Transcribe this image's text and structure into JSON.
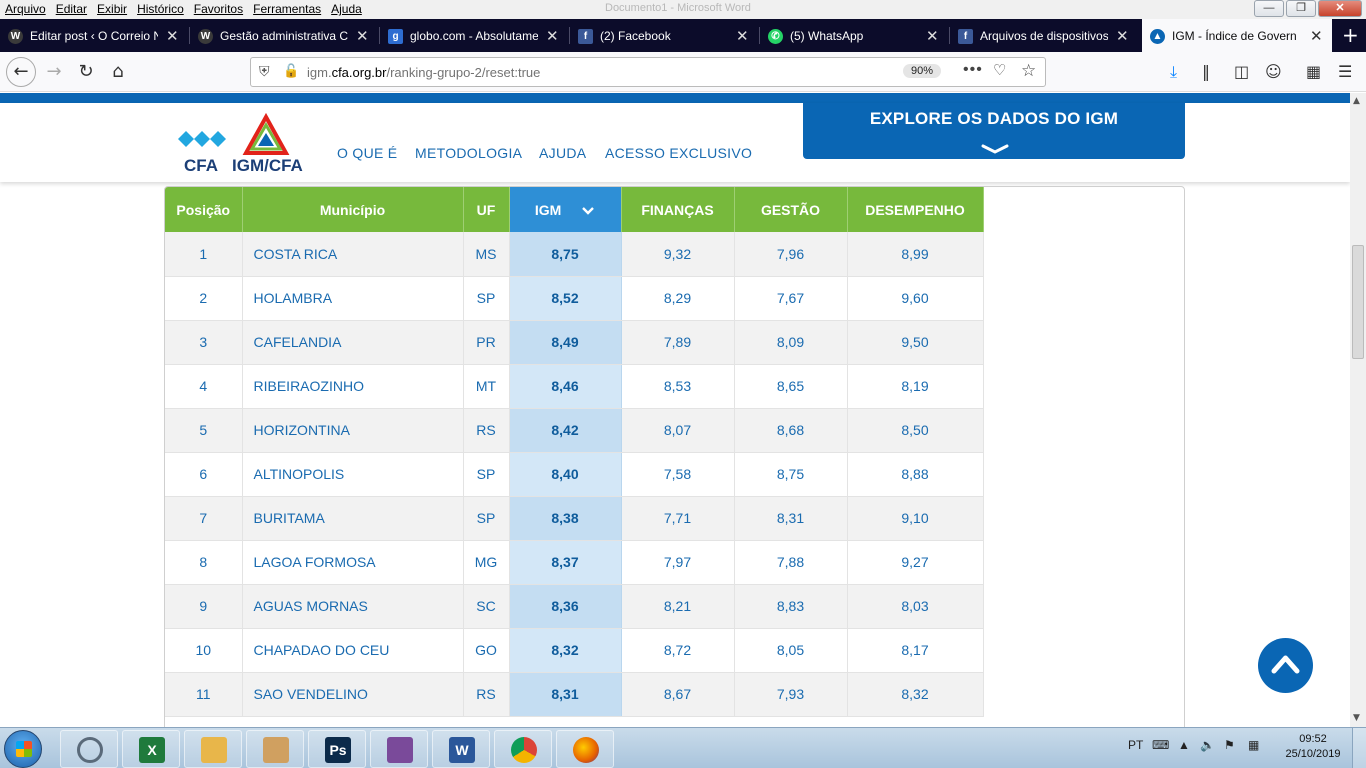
{
  "menu": {
    "items": [
      "Arquivo",
      "Editar",
      "Exibir",
      "Histórico",
      "Favoritos",
      "Ferramentas",
      "Ajuda"
    ],
    "ghost_title": "Documento1 - Microsoft Word"
  },
  "tabs": [
    {
      "title": "Editar post ‹ O Correio N",
      "icon": "wordpress-icon",
      "color": "#3a3a3a"
    },
    {
      "title": "Gestão administrativa CF",
      "icon": "wordpress-icon",
      "color": "#3a3a3a"
    },
    {
      "title": "globo.com - Absolutame",
      "icon": "globo-icon",
      "color": "#2e6dd1"
    },
    {
      "title": "(2) Facebook",
      "icon": "facebook-icon",
      "color": "#3b5998"
    },
    {
      "title": "(5) WhatsApp",
      "icon": "whatsapp-icon",
      "color": "#25d366"
    },
    {
      "title": "Arquivos de dispositivos",
      "icon": "facebook-icon",
      "color": "#3b5998"
    },
    {
      "title": "IGM - Índice de Governa",
      "icon": "igm-icon",
      "color": "#0a66b4"
    }
  ],
  "address": {
    "pre": "igm.",
    "domain": "cfa.org.br",
    "path": "/ranking-grupo-2/reset:true",
    "zoom": "90%"
  },
  "site": {
    "logo_cfa": "CFA",
    "logo_igm": "IGM/CFA",
    "nav": [
      "O QUE É",
      "METODOLOGIA",
      "AJUDA",
      "ACESSO EXCLUSIVO"
    ],
    "explore": "EXPLORE OS DADOS DO IGM"
  },
  "table": {
    "headers": [
      "Posição",
      "Município",
      "UF",
      "IGM",
      "FINANÇAS",
      "GESTÃO",
      "DESEMPENHO"
    ],
    "sorted_column": "IGM",
    "rows": [
      {
        "pos": "1",
        "mun": "COSTA RICA",
        "uf": "MS",
        "igm": "8,75",
        "fin": "9,32",
        "ges": "7,96",
        "des": "8,99"
      },
      {
        "pos": "2",
        "mun": "HOLAMBRA",
        "uf": "SP",
        "igm": "8,52",
        "fin": "8,29",
        "ges": "7,67",
        "des": "9,60"
      },
      {
        "pos": "3",
        "mun": "CAFELANDIA",
        "uf": "PR",
        "igm": "8,49",
        "fin": "7,89",
        "ges": "8,09",
        "des": "9,50"
      },
      {
        "pos": "4",
        "mun": "RIBEIRAOZINHO",
        "uf": "MT",
        "igm": "8,46",
        "fin": "8,53",
        "ges": "8,65",
        "des": "8,19"
      },
      {
        "pos": "5",
        "mun": "HORIZONTINA",
        "uf": "RS",
        "igm": "8,42",
        "fin": "8,07",
        "ges": "8,68",
        "des": "8,50"
      },
      {
        "pos": "6",
        "mun": "ALTINOPOLIS",
        "uf": "SP",
        "igm": "8,40",
        "fin": "7,58",
        "ges": "8,75",
        "des": "8,88"
      },
      {
        "pos": "7",
        "mun": "BURITAMA",
        "uf": "SP",
        "igm": "8,38",
        "fin": "7,71",
        "ges": "8,31",
        "des": "9,10"
      },
      {
        "pos": "8",
        "mun": "LAGOA FORMOSA",
        "uf": "MG",
        "igm": "8,37",
        "fin": "7,97",
        "ges": "7,88",
        "des": "9,27"
      },
      {
        "pos": "9",
        "mun": "AGUAS MORNAS",
        "uf": "SC",
        "igm": "8,36",
        "fin": "8,21",
        "ges": "8,83",
        "des": "8,03"
      },
      {
        "pos": "10",
        "mun": "CHAPADAO DO CEU",
        "uf": "GO",
        "igm": "8,32",
        "fin": "8,72",
        "ges": "8,05",
        "des": "8,17"
      },
      {
        "pos": "11",
        "mun": "SAO VENDELINO",
        "uf": "RS",
        "igm": "8,31",
        "fin": "8,67",
        "ges": "7,93",
        "des": "8,32"
      }
    ]
  },
  "taskbar": {
    "apps": [
      {
        "name": "app-icon",
        "color": "#ffffff",
        "label": ""
      },
      {
        "name": "excel-icon",
        "color": "#1f7a3c",
        "label": "X"
      },
      {
        "name": "folder-icon",
        "color": "#e8b64a",
        "label": ""
      },
      {
        "name": "paint-icon",
        "color": "#d0a060",
        "label": ""
      },
      {
        "name": "photoshop-icon",
        "color": "#0b2a4a",
        "label": "Ps"
      },
      {
        "name": "movie-maker-icon",
        "color": "#7a4a9a",
        "label": ""
      },
      {
        "name": "word-icon",
        "color": "#2b579a",
        "label": "W"
      },
      {
        "name": "chrome-icon",
        "color": "#db4437",
        "label": ""
      },
      {
        "name": "firefox-icon",
        "color": "#e66000",
        "label": ""
      }
    ],
    "lang": "PT",
    "time": "09:52",
    "date": "25/10/2019"
  },
  "colors": {
    "brand_blue": "#0a66b4",
    "header_green": "#77b93c",
    "igm_highlight": "#cce3f5"
  }
}
